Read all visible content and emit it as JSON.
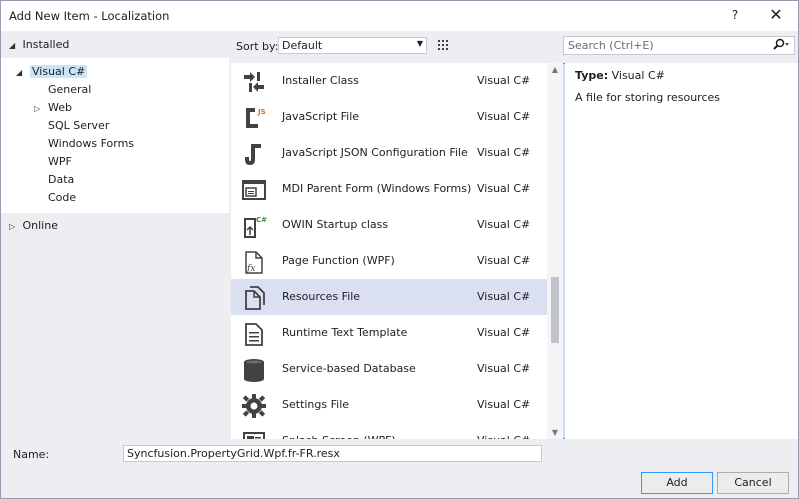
{
  "window": {
    "title": "Add New Item - Localization",
    "help_label": "?",
    "close_label": "✕"
  },
  "left": {
    "installed_label": "Installed",
    "tree": [
      {
        "label": "Visual C#",
        "level": 1,
        "expander": "expanded",
        "selected": true
      },
      {
        "label": "General",
        "level": 2,
        "expander": "none"
      },
      {
        "label": "Web",
        "level": 2,
        "expander": "collapsed"
      },
      {
        "label": "SQL Server",
        "level": 2,
        "expander": "none"
      },
      {
        "label": "Windows Forms",
        "level": 2,
        "expander": "none"
      },
      {
        "label": "WPF",
        "level": 2,
        "expander": "none"
      },
      {
        "label": "Data",
        "level": 2,
        "expander": "none"
      },
      {
        "label": "Code",
        "level": 2,
        "expander": "none"
      }
    ],
    "online_label": "Online"
  },
  "toolbar": {
    "sort_label": "Sort by:",
    "sort_value": "Default",
    "search_placeholder": "Search (Ctrl+E)"
  },
  "items": [
    {
      "name": "Installer Class",
      "lang": "Visual C#",
      "icon": "installer-icon"
    },
    {
      "name": "JavaScript File",
      "lang": "Visual C#",
      "icon": "javascript-file-icon"
    },
    {
      "name": "JavaScript JSON Configuration File",
      "lang": "Visual C#",
      "icon": "json-config-icon"
    },
    {
      "name": "MDI Parent Form (Windows Forms)",
      "lang": "Visual C#",
      "icon": "mdi-form-icon"
    },
    {
      "name": "OWIN Startup class",
      "lang": "Visual C#",
      "icon": "owin-class-icon"
    },
    {
      "name": "Page Function (WPF)",
      "lang": "Visual C#",
      "icon": "page-function-icon"
    },
    {
      "name": "Resources File",
      "lang": "Visual C#",
      "icon": "resources-file-icon",
      "selected": true
    },
    {
      "name": "Runtime Text Template",
      "lang": "Visual C#",
      "icon": "text-template-icon"
    },
    {
      "name": "Service-based Database",
      "lang": "Visual C#",
      "icon": "database-icon"
    },
    {
      "name": "Settings File",
      "lang": "Visual C#",
      "icon": "settings-gear-icon"
    },
    {
      "name": "Splash Screen (WPF)",
      "lang": "Visual C#",
      "icon": "splash-screen-icon"
    }
  ],
  "details": {
    "type_label": "Type:",
    "type_value": "Visual C#",
    "description": "A file for storing resources"
  },
  "bottom": {
    "name_label": "Name:",
    "name_value": "Syncfusion.PropertyGrid.Wpf.fr-FR.resx",
    "add_label": "Add",
    "cancel_label": "Cancel"
  }
}
